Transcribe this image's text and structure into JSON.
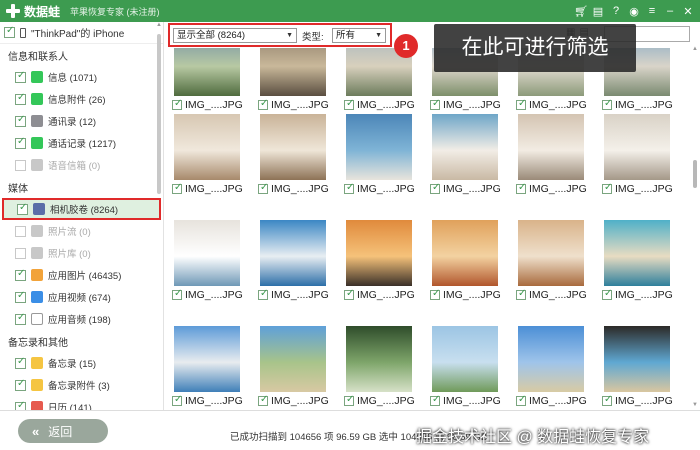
{
  "titlebar": {
    "app_name": "数据蛙",
    "edition": "苹果恢复专家 (未注册)",
    "controls": [
      "cart-icon",
      "gift-icon",
      "help-icon",
      "chat-icon",
      "menu-icon",
      "minimize-icon",
      "close-icon"
    ]
  },
  "sidebar": {
    "device_label": "\"ThinkPad\"的 iPhone",
    "groups": [
      {
        "title": "信息和联系人",
        "items": [
          {
            "label": "信息 (1071)",
            "checked": true,
            "enabled": true,
            "icon": "message-icon",
            "color": "#34c759"
          },
          {
            "label": "信息附件 (26)",
            "checked": true,
            "enabled": true,
            "icon": "message-attachment-icon",
            "color": "#34c759"
          },
          {
            "label": "通讯录 (12)",
            "checked": true,
            "enabled": true,
            "icon": "contacts-icon",
            "color": "#8e8e93"
          },
          {
            "label": "通话记录 (1217)",
            "checked": true,
            "enabled": true,
            "icon": "call-log-icon",
            "color": "#34c759"
          },
          {
            "label": "语音信箱 (0)",
            "checked": false,
            "enabled": false,
            "icon": "voicemail-icon",
            "color": "#c8c8c8"
          }
        ]
      },
      {
        "title": "媒体",
        "items": [
          {
            "label": "相机胶卷 (8264)",
            "checked": true,
            "enabled": true,
            "icon": "camera-roll-icon",
            "color": "#5b6ea8",
            "selected": true
          },
          {
            "label": "照片流 (0)",
            "checked": false,
            "enabled": false,
            "icon": "photo-stream-icon",
            "color": "#c8c8c8"
          },
          {
            "label": "照片库 (0)",
            "checked": false,
            "enabled": false,
            "icon": "photo-library-icon",
            "color": "#c8c8c8"
          },
          {
            "label": "应用图片 (46435)",
            "checked": true,
            "enabled": true,
            "icon": "app-photos-icon",
            "color": "#f2a33a"
          },
          {
            "label": "应用视频 (674)",
            "checked": true,
            "enabled": true,
            "icon": "app-videos-icon",
            "color": "#3b8ee6"
          },
          {
            "label": "应用音频 (198)",
            "checked": true,
            "enabled": true,
            "icon": "app-audio-icon",
            "color": "#ffffff"
          }
        ]
      },
      {
        "title": "备忘录和其他",
        "items": [
          {
            "label": "备忘录 (15)",
            "checked": true,
            "enabled": true,
            "icon": "notes-icon",
            "color": "#f5c542"
          },
          {
            "label": "备忘录附件 (3)",
            "checked": true,
            "enabled": true,
            "icon": "notes-attachment-icon",
            "color": "#f5c542"
          },
          {
            "label": "日历 (141)",
            "checked": true,
            "enabled": true,
            "icon": "calendar-icon",
            "color": "#e65a4e"
          }
        ]
      }
    ]
  },
  "toolbar": {
    "display_select": "显示全部 (8264)",
    "type_label": "类型:",
    "type_select": "所有"
  },
  "annotation": {
    "badge": "1",
    "tooltip": "在此可进行筛选"
  },
  "grid": {
    "filename": "IMG_....JPG",
    "rows": [
      {
        "cells": [
          {
            "colors": [
              "#6f8ea6",
              "#b8c9a3",
              "#4f6b3e"
            ],
            "checked": true
          },
          {
            "colors": [
              "#8a7a66",
              "#c9b89a",
              "#5a4e40"
            ],
            "checked": true
          },
          {
            "colors": [
              "#a3b5bf",
              "#d8d0bd",
              "#6c7c5c"
            ],
            "checked": true
          },
          {
            "colors": [
              "#8dacc9",
              "#ded7cc",
              "#7d8f6a"
            ],
            "checked": true
          },
          {
            "colors": [
              "#9fb8c9",
              "#e3ddd2",
              "#8c9a7a"
            ],
            "checked": true
          },
          {
            "colors": [
              "#7fa6c4",
              "#d9d4c9",
              "#7a8a70"
            ],
            "checked": true
          }
        ]
      },
      {
        "cells": [
          {
            "colors": [
              "#d7c7b2",
              "#f0e8dc",
              "#a7896b"
            ],
            "checked": true
          },
          {
            "colors": [
              "#c9b398",
              "#efe6d8",
              "#8d7256"
            ],
            "checked": true
          },
          {
            "colors": [
              "#4c86b8",
              "#7fb4d6",
              "#e8e4dc"
            ],
            "checked": true
          },
          {
            "colors": [
              "#6ea6c8",
              "#f2ede6",
              "#c9b9a4"
            ],
            "checked": true
          },
          {
            "colors": [
              "#d4c4b2",
              "#f2ece3",
              "#9a8a78"
            ],
            "checked": true
          },
          {
            "colors": [
              "#d9d2c6",
              "#f4f0ea",
              "#a49888"
            ],
            "checked": true
          }
        ]
      },
      {
        "cells": [
          {
            "colors": [
              "#e7e3dd",
              "#ffffff",
              "#6f98b6"
            ],
            "checked": true
          },
          {
            "colors": [
              "#3b87c4",
              "#e8eef2",
              "#2d6fa8"
            ],
            "checked": true
          },
          {
            "colors": [
              "#e08a3c",
              "#f5c27a",
              "#3a3028"
            ],
            "checked": true
          },
          {
            "colors": [
              "#e0a15b",
              "#f3d2a1",
              "#b1562c"
            ],
            "checked": true
          },
          {
            "colors": [
              "#d9b38a",
              "#efe0cc",
              "#a86a3d"
            ],
            "checked": true
          },
          {
            "colors": [
              "#4fb0c8",
              "#e8dcc2",
              "#2e7f9c"
            ],
            "checked": true
          }
        ]
      },
      {
        "cells": [
          {
            "colors": [
              "#5d9bd8",
              "#e8ecef",
              "#3f7fb8"
            ],
            "checked": true
          },
          {
            "colors": [
              "#5fa0d9",
              "#a8c48a",
              "#d8c9a3"
            ],
            "checked": true
          },
          {
            "colors": [
              "#2f4d2b",
              "#7ea56a",
              "#d7e1c8"
            ],
            "checked": true
          },
          {
            "colors": [
              "#9cc5e4",
              "#c8dfef",
              "#6f9a5a"
            ],
            "checked": true
          },
          {
            "colors": [
              "#4c8fd6",
              "#9fc4ea",
              "#d8cba4"
            ],
            "checked": true
          },
          {
            "colors": [
              "#2c2a27",
              "#5fa8d2",
              "#d9c6a0"
            ],
            "checked": true
          }
        ]
      }
    ]
  },
  "bottom": {
    "back_label": "返回",
    "status": "已成功扫描到 104656 项 96.59 GB  选中 104656 项 96.59 GB",
    "watermark": "掘金技术社区 @ 数据蛙恢复专家"
  }
}
